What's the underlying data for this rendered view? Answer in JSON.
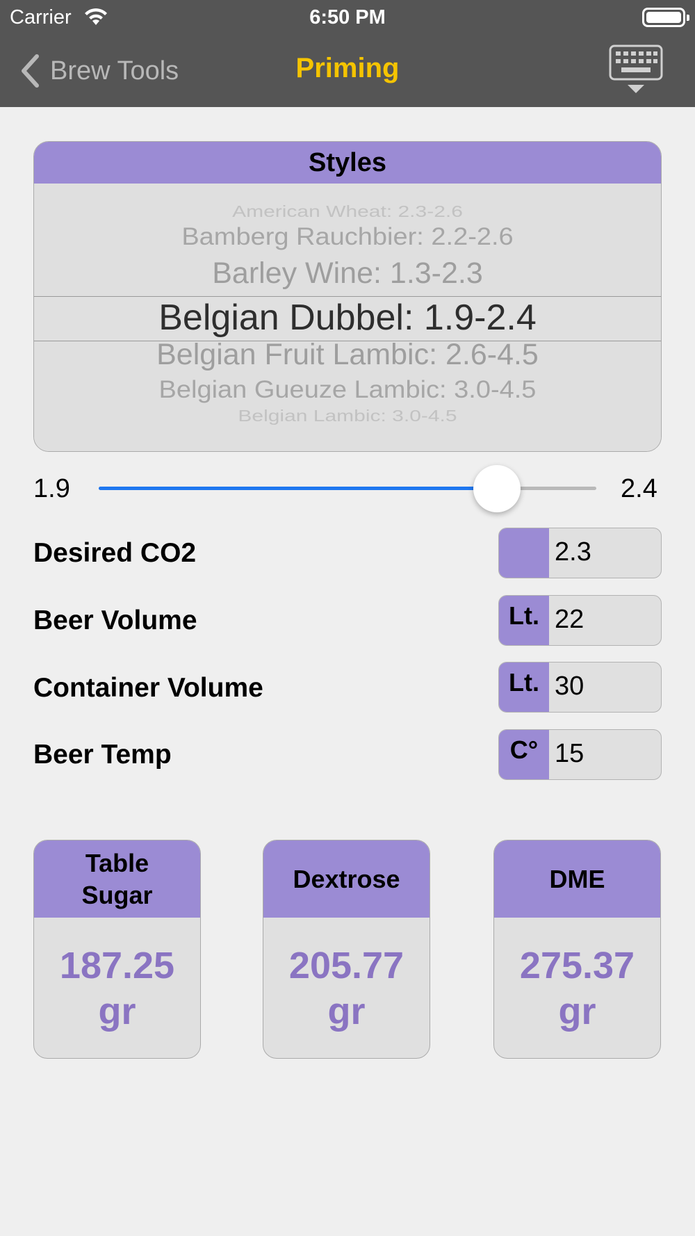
{
  "status_bar": {
    "carrier": "Carrier",
    "time": "6:50 PM"
  },
  "nav": {
    "back_label": "Brew Tools",
    "title": "Priming",
    "title_color": "#f5c400",
    "keyboard_icon": "keyboard-dismiss-icon"
  },
  "styles": {
    "header": "Styles",
    "options": [
      "American Wheat: 2.3-2.6",
      "Bamberg Rauchbier: 2.2-2.6",
      "Barley Wine: 1.3-2.3",
      "Belgian Dubbel: 1.9-2.4",
      "Belgian Fruit Lambic: 2.6-4.5",
      "Belgian Gueuze Lambic: 3.0-4.5",
      "Belgian Lambic: 3.0-4.5"
    ],
    "selected": "Belgian Dubbel: 1.9-2.4"
  },
  "slider": {
    "min_label": "1.9",
    "max_label": "2.4",
    "min": 1.9,
    "max": 2.4,
    "value": 2.3,
    "fill_color": "#1f77f0"
  },
  "fields": [
    {
      "label": "Desired CO2",
      "unit": "",
      "value": "2.3"
    },
    {
      "label": "Beer Volume",
      "unit": "Lt.",
      "value": "22"
    },
    {
      "label": "Container Volume",
      "unit": "Lt.",
      "value": "30"
    },
    {
      "label": "Beer Temp",
      "unit": "C°",
      "value": "15"
    }
  ],
  "results": [
    {
      "title_line1": "Table",
      "title_line2": "Sugar",
      "amount": "187.25",
      "unit": "gr"
    },
    {
      "title_line1": "Dextrose",
      "title_line2": "",
      "amount": "205.77",
      "unit": "gr"
    },
    {
      "title_line1": "DME",
      "title_line2": "",
      "amount": "275.37",
      "unit": "gr"
    }
  ],
  "colors": {
    "accent": "#9b8bd4",
    "result_text": "#8a74c2",
    "nav_bar": "#555555"
  }
}
